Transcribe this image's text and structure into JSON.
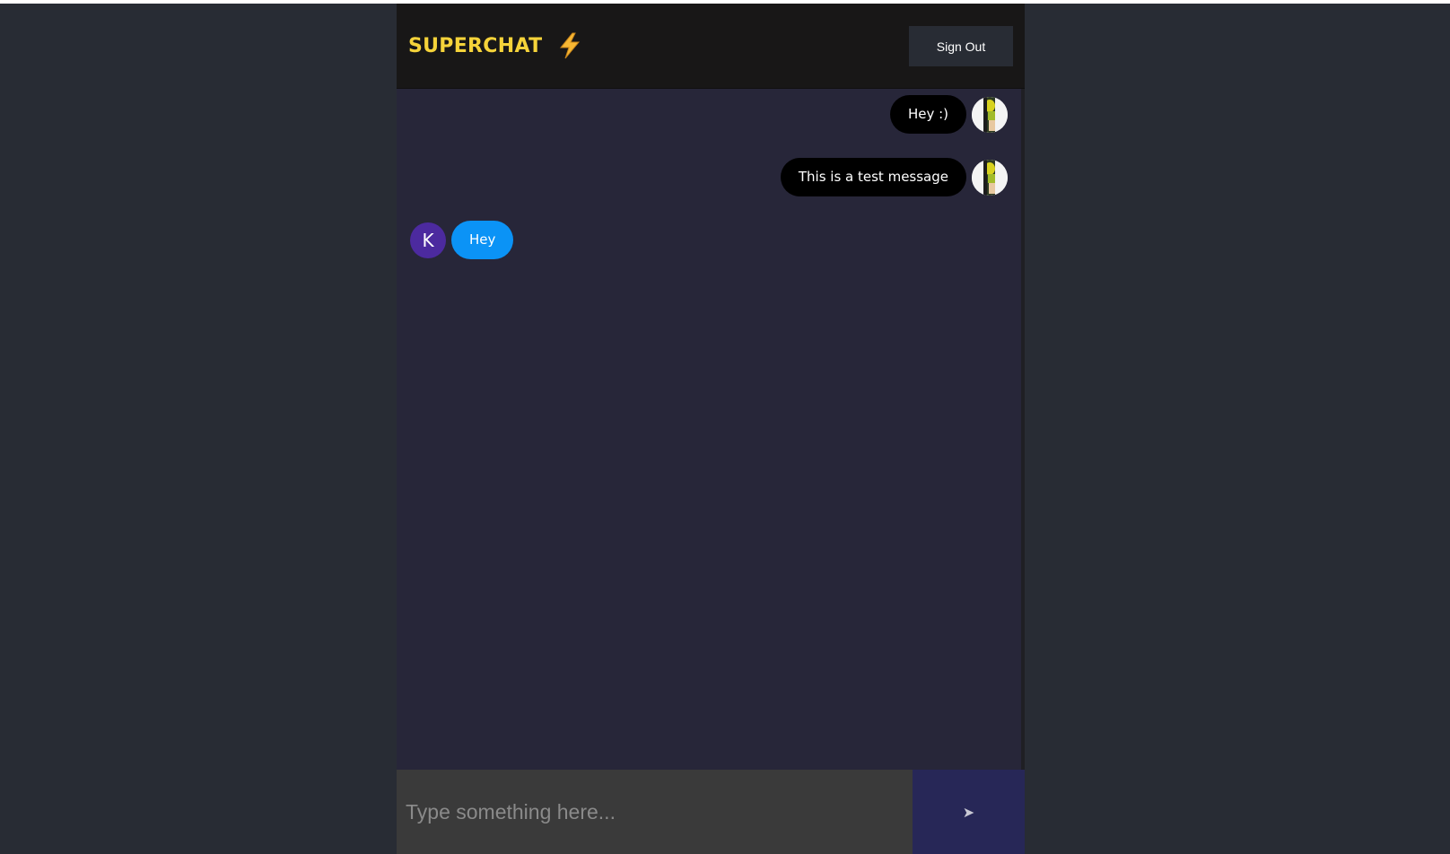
{
  "header": {
    "title": "SUPERCHAT",
    "title_icon": "lightning-bolt-icon",
    "signout_label": "Sign Out"
  },
  "messages": [
    {
      "text": "Hey :)",
      "type": "sent",
      "avatar": "user-photo"
    },
    {
      "text": "This is a test message",
      "type": "sent",
      "avatar": "user-photo"
    },
    {
      "text": "Hey",
      "type": "received",
      "avatar_letter": "K"
    }
  ],
  "form": {
    "placeholder": "Type something here...",
    "send_label": "➤",
    "send_icon": "send-arrow-icon"
  },
  "colors": {
    "brand": "#f5d33a",
    "sent_bubble": "#000000",
    "received_bubble": "#0b93f6",
    "avatar_letter_bg": "#4c2a9f",
    "send_button": "#272757"
  }
}
